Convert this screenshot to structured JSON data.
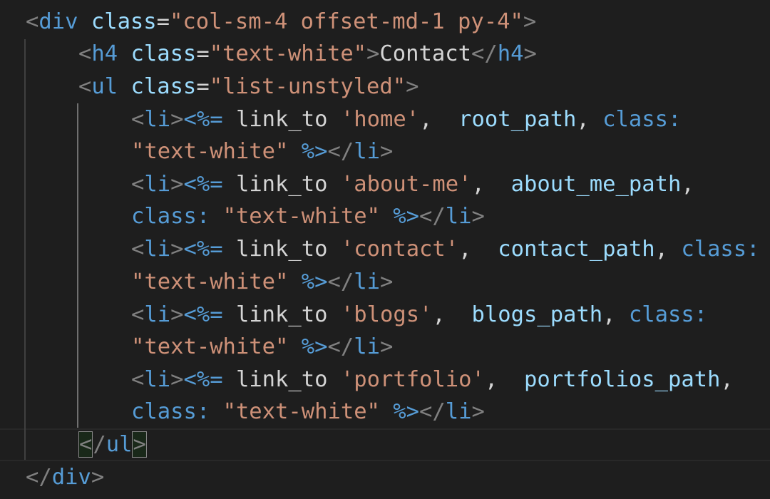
{
  "editor": {
    "lines": [
      {
        "tokens": [
          {
            "text": "<",
            "cls": "t-punc"
          },
          {
            "text": "div",
            "cls": "t-tag"
          },
          {
            "text": " ",
            "cls": "t-plain"
          },
          {
            "text": "class",
            "cls": "t-attr"
          },
          {
            "text": "=",
            "cls": "t-plain"
          },
          {
            "text": "\"col-sm-4 offset-md-1 py-4\"",
            "cls": "t-str"
          },
          {
            "text": ">",
            "cls": "t-punc"
          }
        ]
      },
      {
        "tokens": [
          {
            "text": "<",
            "cls": "t-punc"
          },
          {
            "text": "h4",
            "cls": "t-tag"
          },
          {
            "text": " ",
            "cls": "t-plain"
          },
          {
            "text": "class",
            "cls": "t-attr"
          },
          {
            "text": "=",
            "cls": "t-plain"
          },
          {
            "text": "\"text-white\"",
            "cls": "t-str"
          },
          {
            "text": ">",
            "cls": "t-punc"
          },
          {
            "text": "Contact",
            "cls": "t-text"
          },
          {
            "text": "</",
            "cls": "t-punc"
          },
          {
            "text": "h4",
            "cls": "t-tag"
          },
          {
            "text": ">",
            "cls": "t-punc"
          }
        ]
      },
      {
        "tokens": [
          {
            "text": "<",
            "cls": "t-punc"
          },
          {
            "text": "ul",
            "cls": "t-tag"
          },
          {
            "text": " ",
            "cls": "t-plain"
          },
          {
            "text": "class",
            "cls": "t-attr"
          },
          {
            "text": "=",
            "cls": "t-plain"
          },
          {
            "text": "\"list-unstyled\"",
            "cls": "t-str"
          },
          {
            "text": ">",
            "cls": "t-punc"
          }
        ]
      },
      {
        "tokens": [
          {
            "text": "<",
            "cls": "t-punc"
          },
          {
            "text": "li",
            "cls": "t-tag"
          },
          {
            "text": ">",
            "cls": "t-punc"
          },
          {
            "text": "<%=",
            "cls": "t-erb"
          },
          {
            "text": " ",
            "cls": "t-plain"
          },
          {
            "text": "link_to",
            "cls": "t-plain"
          },
          {
            "text": " ",
            "cls": "t-plain"
          },
          {
            "text": "'home'",
            "cls": "t-str"
          },
          {
            "text": ",  ",
            "cls": "t-plain"
          },
          {
            "text": "root_path",
            "cls": "t-ident"
          },
          {
            "text": ", ",
            "cls": "t-plain"
          },
          {
            "text": "class:",
            "cls": "t-sym"
          }
        ]
      },
      {
        "tokens": [
          {
            "text": "\"text-white\"",
            "cls": "t-str"
          },
          {
            "text": " ",
            "cls": "t-plain"
          },
          {
            "text": "%>",
            "cls": "t-erb"
          },
          {
            "text": "</",
            "cls": "t-punc"
          },
          {
            "text": "li",
            "cls": "t-tag"
          },
          {
            "text": ">",
            "cls": "t-punc"
          }
        ]
      },
      {
        "tokens": [
          {
            "text": "<",
            "cls": "t-punc"
          },
          {
            "text": "li",
            "cls": "t-tag"
          },
          {
            "text": ">",
            "cls": "t-punc"
          },
          {
            "text": "<%=",
            "cls": "t-erb"
          },
          {
            "text": " ",
            "cls": "t-plain"
          },
          {
            "text": "link_to",
            "cls": "t-plain"
          },
          {
            "text": " ",
            "cls": "t-plain"
          },
          {
            "text": "'about-me'",
            "cls": "t-str"
          },
          {
            "text": ",  ",
            "cls": "t-plain"
          },
          {
            "text": "about_me_path",
            "cls": "t-ident"
          },
          {
            "text": ",",
            "cls": "t-plain"
          }
        ]
      },
      {
        "tokens": [
          {
            "text": "class:",
            "cls": "t-sym"
          },
          {
            "text": " ",
            "cls": "t-plain"
          },
          {
            "text": "\"text-white\"",
            "cls": "t-str"
          },
          {
            "text": " ",
            "cls": "t-plain"
          },
          {
            "text": "%>",
            "cls": "t-erb"
          },
          {
            "text": "</",
            "cls": "t-punc"
          },
          {
            "text": "li",
            "cls": "t-tag"
          },
          {
            "text": ">",
            "cls": "t-punc"
          }
        ]
      },
      {
        "tokens": [
          {
            "text": "<",
            "cls": "t-punc"
          },
          {
            "text": "li",
            "cls": "t-tag"
          },
          {
            "text": ">",
            "cls": "t-punc"
          },
          {
            "text": "<%=",
            "cls": "t-erb"
          },
          {
            "text": " ",
            "cls": "t-plain"
          },
          {
            "text": "link_to",
            "cls": "t-plain"
          },
          {
            "text": " ",
            "cls": "t-plain"
          },
          {
            "text": "'contact'",
            "cls": "t-str"
          },
          {
            "text": ",  ",
            "cls": "t-plain"
          },
          {
            "text": "contact_path",
            "cls": "t-ident"
          },
          {
            "text": ", ",
            "cls": "t-plain"
          },
          {
            "text": "class:",
            "cls": "t-sym"
          }
        ]
      },
      {
        "tokens": [
          {
            "text": "\"text-white\"",
            "cls": "t-str"
          },
          {
            "text": " ",
            "cls": "t-plain"
          },
          {
            "text": "%>",
            "cls": "t-erb"
          },
          {
            "text": "</",
            "cls": "t-punc"
          },
          {
            "text": "li",
            "cls": "t-tag"
          },
          {
            "text": ">",
            "cls": "t-punc"
          }
        ]
      },
      {
        "tokens": [
          {
            "text": "<",
            "cls": "t-punc"
          },
          {
            "text": "li",
            "cls": "t-tag"
          },
          {
            "text": ">",
            "cls": "t-punc"
          },
          {
            "text": "<%=",
            "cls": "t-erb"
          },
          {
            "text": " ",
            "cls": "t-plain"
          },
          {
            "text": "link_to",
            "cls": "t-plain"
          },
          {
            "text": " ",
            "cls": "t-plain"
          },
          {
            "text": "'blogs'",
            "cls": "t-str"
          },
          {
            "text": ",  ",
            "cls": "t-plain"
          },
          {
            "text": "blogs_path",
            "cls": "t-ident"
          },
          {
            "text": ", ",
            "cls": "t-plain"
          },
          {
            "text": "class:",
            "cls": "t-sym"
          }
        ]
      },
      {
        "tokens": [
          {
            "text": "\"text-white\"",
            "cls": "t-str"
          },
          {
            "text": " ",
            "cls": "t-plain"
          },
          {
            "text": "%>",
            "cls": "t-erb"
          },
          {
            "text": "</",
            "cls": "t-punc"
          },
          {
            "text": "li",
            "cls": "t-tag"
          },
          {
            "text": ">",
            "cls": "t-punc"
          }
        ]
      },
      {
        "tokens": [
          {
            "text": "<",
            "cls": "t-punc"
          },
          {
            "text": "li",
            "cls": "t-tag"
          },
          {
            "text": ">",
            "cls": "t-punc"
          },
          {
            "text": "<%=",
            "cls": "t-erb"
          },
          {
            "text": " ",
            "cls": "t-plain"
          },
          {
            "text": "link_to",
            "cls": "t-plain"
          },
          {
            "text": " ",
            "cls": "t-plain"
          },
          {
            "text": "'portfolio'",
            "cls": "t-str"
          },
          {
            "text": ",  ",
            "cls": "t-plain"
          },
          {
            "text": "portfolios_path",
            "cls": "t-ident"
          },
          {
            "text": ",",
            "cls": "t-plain"
          }
        ]
      },
      {
        "tokens": [
          {
            "text": "class:",
            "cls": "t-sym"
          },
          {
            "text": " ",
            "cls": "t-plain"
          },
          {
            "text": "\"text-white\"",
            "cls": "t-str"
          },
          {
            "text": " ",
            "cls": "t-plain"
          },
          {
            "text": "%>",
            "cls": "t-erb"
          },
          {
            "text": "</",
            "cls": "t-punc"
          },
          {
            "text": "li",
            "cls": "t-tag"
          },
          {
            "text": ">",
            "cls": "t-punc"
          }
        ]
      },
      {
        "tokens": [
          {
            "text": "<",
            "cls": "t-punc"
          },
          {
            "text": "/",
            "cls": "t-punc"
          },
          {
            "text": "ul",
            "cls": "t-tag"
          },
          {
            "text": ">",
            "cls": "t-punc"
          }
        ]
      },
      {
        "tokens": [
          {
            "text": "</",
            "cls": "t-punc"
          },
          {
            "text": "div",
            "cls": "t-tag"
          },
          {
            "text": ">",
            "cls": "t-punc"
          }
        ]
      }
    ]
  }
}
